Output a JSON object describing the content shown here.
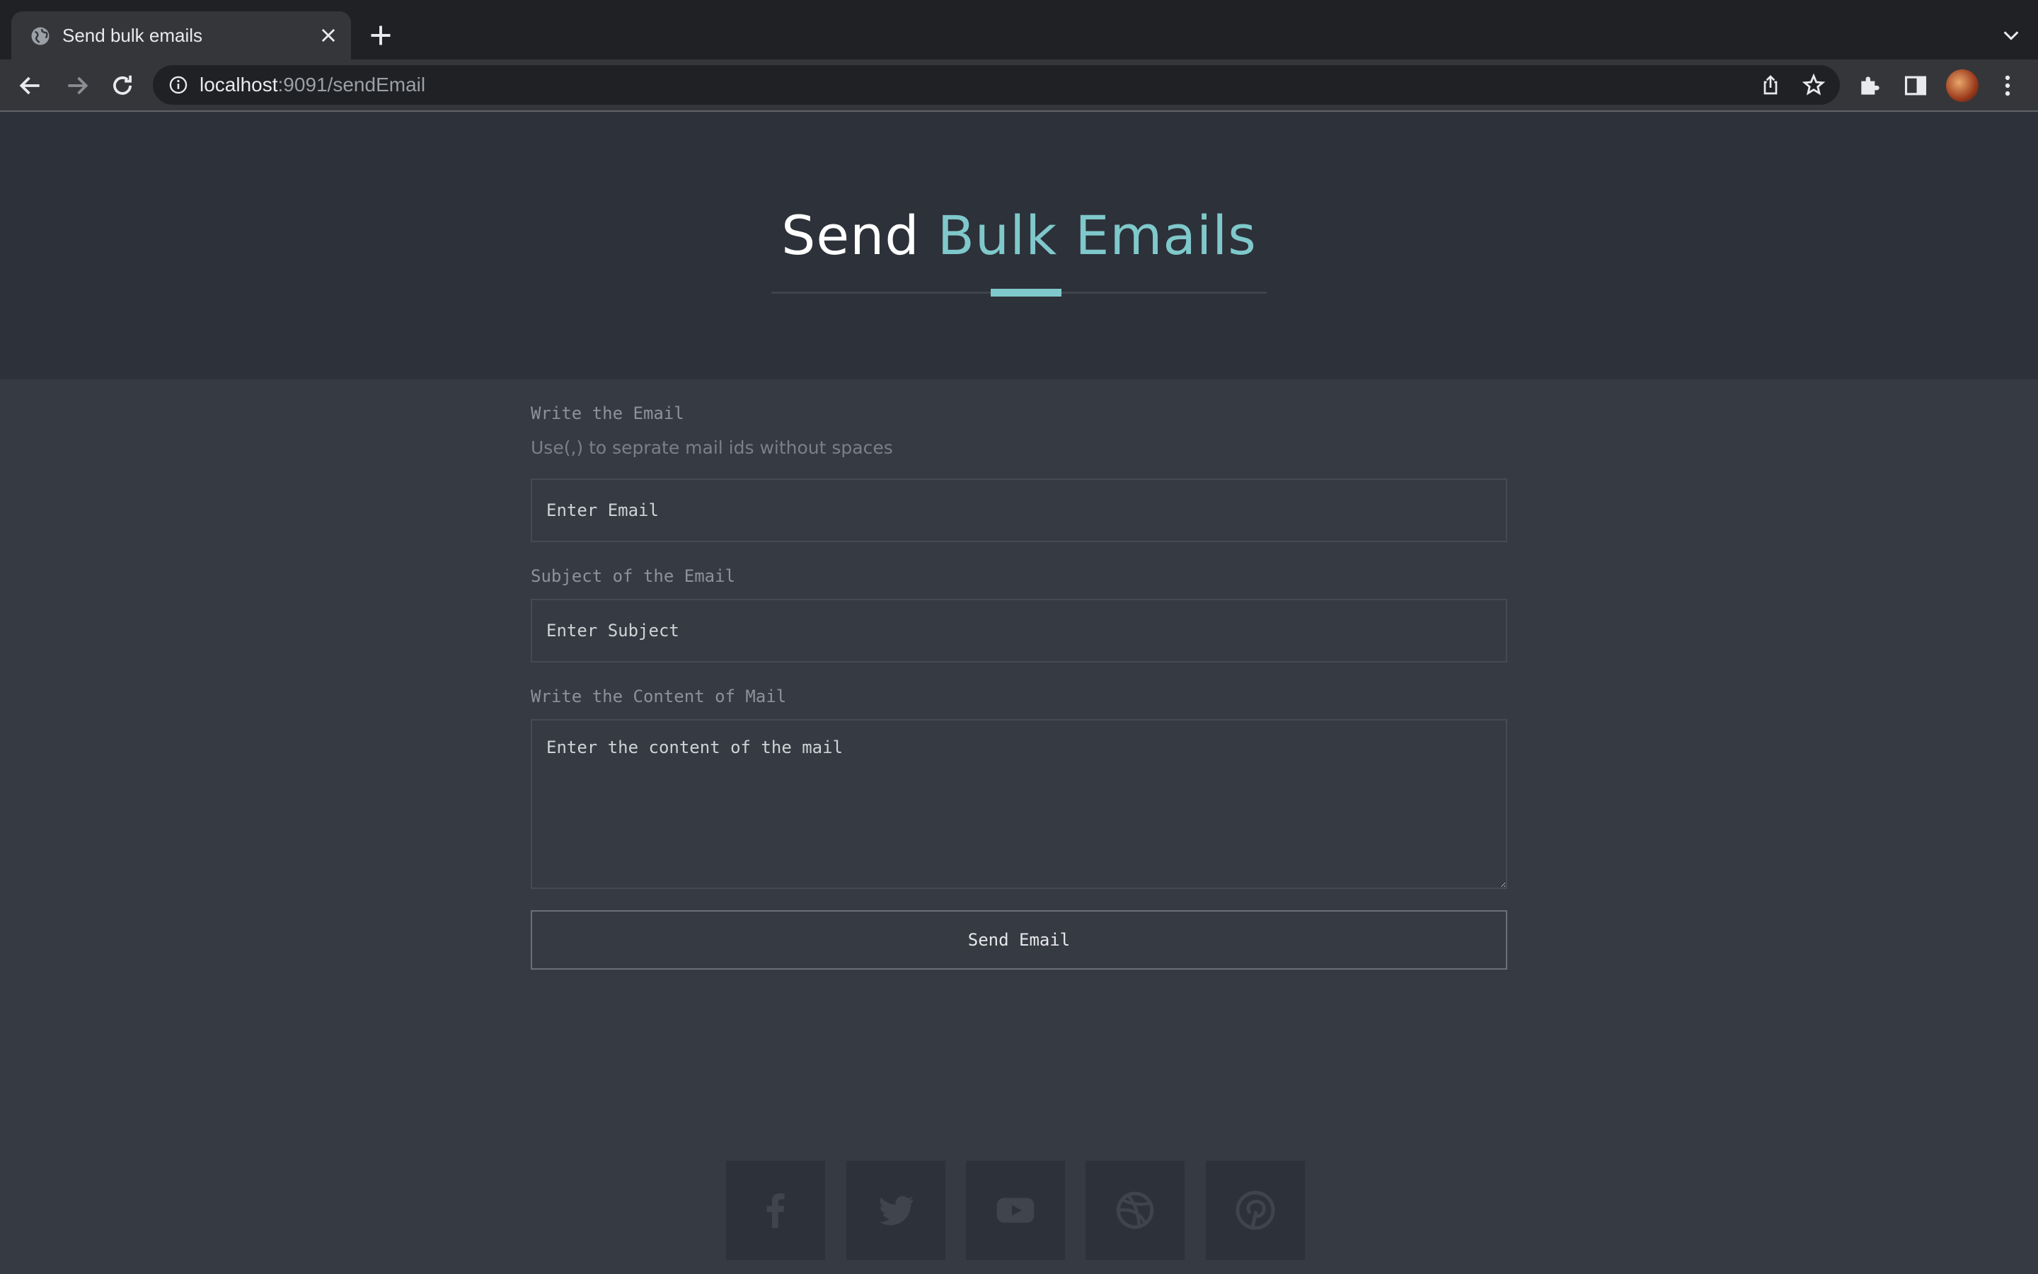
{
  "browser": {
    "tab_title": "Send bulk emails",
    "url_host": "localhost",
    "url_rest": ":9091/sendEmail"
  },
  "header": {
    "title_plain": "Send",
    "title_accent": "Bulk Emails",
    "accent_color": "#7fc8cb"
  },
  "form": {
    "email_label": "Write the Email",
    "email_hint": "Use(,) to seprate mail ids without spaces",
    "email_placeholder": "Enter Email",
    "subject_label": "Subject of the Email",
    "subject_placeholder": "Enter Subject",
    "content_label": "Write the Content of Mail",
    "content_placeholder": "Enter the content of the mail",
    "submit_label": "Send Email"
  },
  "social": [
    "facebook-icon",
    "twitter-icon",
    "youtube-icon",
    "dribbble-icon",
    "pinterest-icon"
  ]
}
